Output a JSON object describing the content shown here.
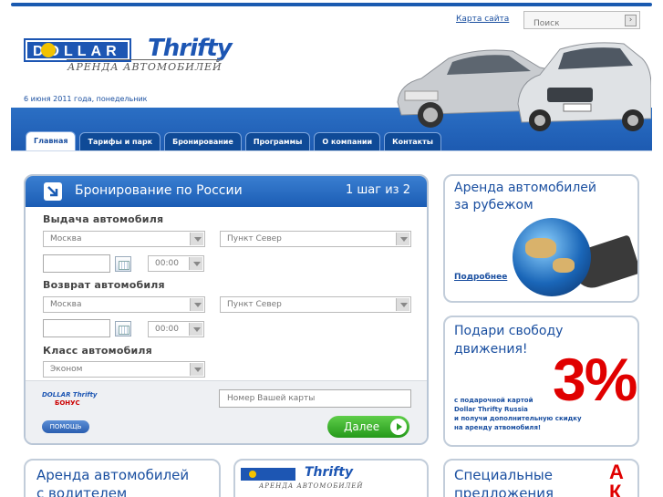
{
  "header": {
    "logo_dollar": "DOLLAR",
    "logo_thrifty": "Thrifty",
    "logo_subtitle": "АРЕНДА АВТОМОБИЛЕЙ",
    "date": "6 июня 2011 года, понедельник",
    "sitemap_label": "Карта сайта",
    "search_placeholder": "Поиск"
  },
  "nav": {
    "tabs": [
      {
        "label": "Главная"
      },
      {
        "label": "Тарифы и парк"
      },
      {
        "label": "Бронирование"
      },
      {
        "label": "Программы"
      },
      {
        "label": "О компании"
      },
      {
        "label": "Контакты"
      }
    ]
  },
  "booking": {
    "title": "Бронирование по России",
    "step": "1 шаг из 2",
    "pickup_label": "Выдача автомобиля",
    "pickup_city": "Москва",
    "pickup_point": "Пункт Север",
    "pickup_time": "00:00",
    "return_label": "Возврат автомобиля",
    "return_city": "Москва",
    "return_point": "Пункт Север",
    "return_time": "00:00",
    "class_label": "Класс автомобиля",
    "class_value": "Эконом",
    "bonus_brand": "DOLLAR Thrifty",
    "bonus_label": "БОНУС",
    "card_placeholder": "Номер Вашей карты",
    "help_label": "ПОМОЩЬ",
    "next_label": "Далее"
  },
  "promos": {
    "abroad_title_1": "Аренда автомобилей",
    "abroad_title_2": "за рубежом",
    "abroad_more": "Подробнее",
    "gift_title_1": "Подари свободу",
    "gift_title_2": "движения!",
    "gift_percent": "3%",
    "gift_text_1": "с подарочной картой",
    "gift_text_2": "Dollar Thrifty Russia",
    "gift_text_3": "и получи дополнительную скидку",
    "gift_text_4": "на аренду атвомобиля!",
    "driver_title_1": "Аренда автомобилей",
    "driver_title_2": "с водителем",
    "special_title_1": "Специальные",
    "special_title_2": "предложения",
    "special_letter_1": "А",
    "special_letter_2": "К"
  },
  "colors": {
    "brand_blue": "#1a56ad",
    "accent_red": "#e00000",
    "next_green": "#24991a"
  }
}
